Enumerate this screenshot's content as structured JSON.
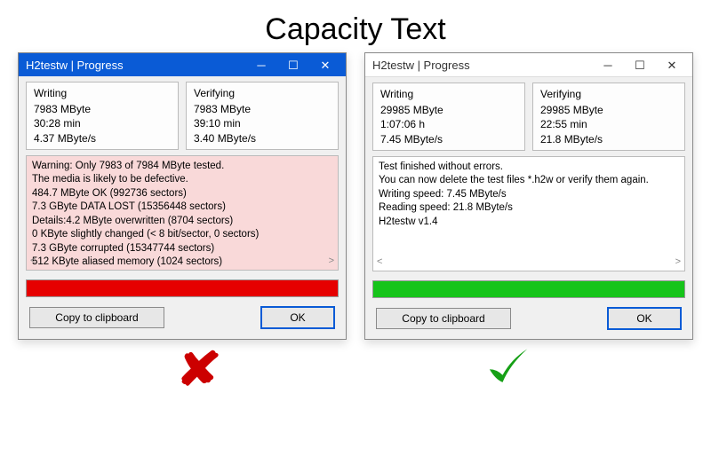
{
  "page_title": "Capacity Text",
  "buttons": {
    "copy": "Copy to clipboard",
    "ok": "OK"
  },
  "windows": [
    {
      "title": "H2testw | Progress",
      "accent": "blue",
      "writing": {
        "label": "Writing",
        "size": "7983 MByte",
        "time": "30:28 min",
        "rate": "4.37 MByte/s"
      },
      "verifying": {
        "label": "Verifying",
        "size": "7983 MByte",
        "time": "39:10 min",
        "rate": "3.40 MByte/s"
      },
      "log": "Warning: Only 7983 of 7984 MByte tested.\nThe media is likely to be defective.\n484.7 MByte OK (992736 sectors)\n7.3 GByte DATA LOST (15356448 sectors)\nDetails:4.2 MByte overwritten (8704 sectors)\n0 KByte slightly changed (< 8 bit/sector, 0 sectors)\n7.3 GByte corrupted (15347744 sectors)\n512 KByte aliased memory (1024 sectors)",
      "log_bg": "pink",
      "progress_color": "red",
      "progress_pct": 100,
      "result": "fail"
    },
    {
      "title": "H2testw | Progress",
      "accent": "grey",
      "writing": {
        "label": "Writing",
        "size": "29985 MByte",
        "time": "1:07:06 h",
        "rate": "7.45 MByte/s"
      },
      "verifying": {
        "label": "Verifying",
        "size": "29985 MByte",
        "time": "22:55 min",
        "rate": "21.8 MByte/s"
      },
      "log": "Test finished without errors.\nYou can now delete the test files *.h2w or verify them again.\nWriting speed: 7.45 MByte/s\nReading speed: 21.8 MByte/s\nH2testw v1.4",
      "log_bg": "white",
      "progress_color": "green",
      "progress_pct": 100,
      "result": "pass"
    }
  ]
}
